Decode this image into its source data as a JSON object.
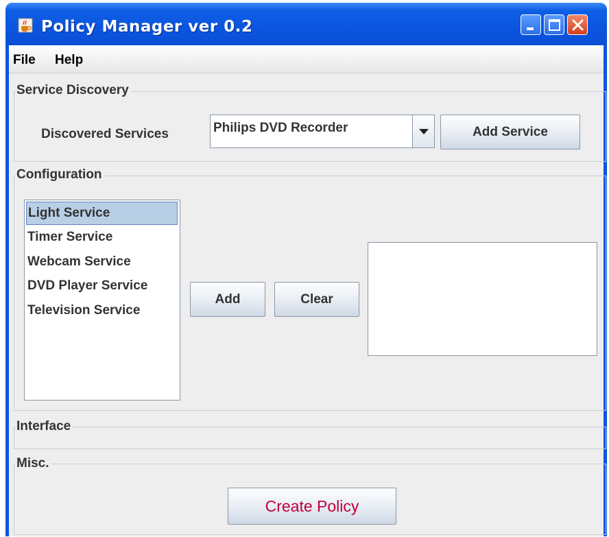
{
  "window": {
    "title": "Policy Manager ver 0.2",
    "icons": {
      "app": "java-cup-icon",
      "minimize": "minimize-icon",
      "maximize": "maximize-icon",
      "close": "close-icon"
    }
  },
  "menu": {
    "file": "File",
    "help": "Help"
  },
  "service_discovery": {
    "title": "Service Discovery",
    "label": "Discovered Services",
    "selected_service": "Philips DVD Recorder",
    "add_button": "Add Service"
  },
  "configuration": {
    "title": "Configuration",
    "services": [
      {
        "label": "Light Service",
        "selected": true
      },
      {
        "label": "Timer Service",
        "selected": false
      },
      {
        "label": "Webcam Service",
        "selected": false
      },
      {
        "label": "DVD Player Service",
        "selected": false
      },
      {
        "label": "Television Service",
        "selected": false
      }
    ],
    "add_button": "Add",
    "clear_button": "Clear",
    "output_text": ""
  },
  "interface": {
    "title": "Interface"
  },
  "misc": {
    "title": "Misc.",
    "create_button": "Create Policy"
  },
  "colors": {
    "titlebar": "#0a55df",
    "create_policy_text": "#c0003a",
    "selection": "#b8cfe5"
  }
}
